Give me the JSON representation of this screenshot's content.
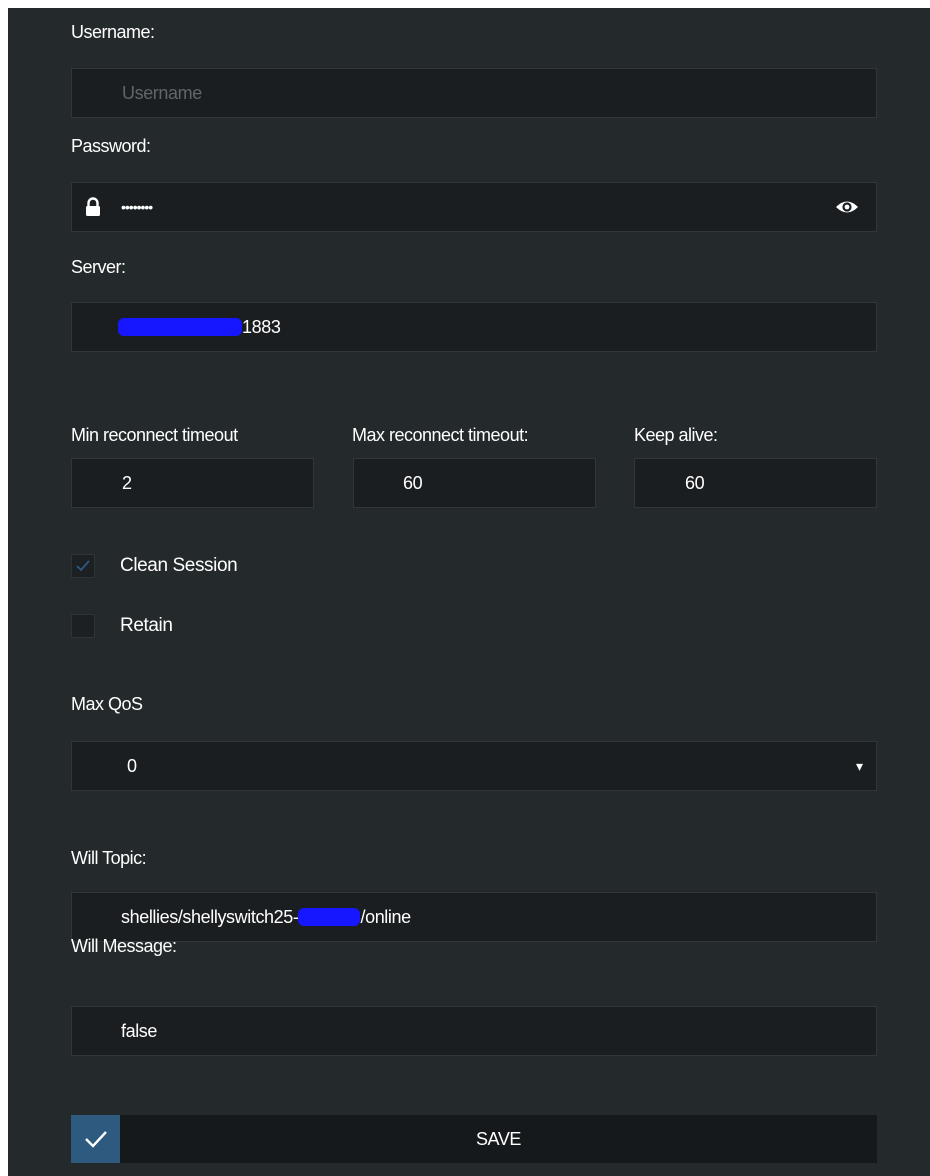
{
  "form": {
    "username": {
      "label": "Username:",
      "placeholder": "Username",
      "value": ""
    },
    "password": {
      "label": "Password:",
      "value": "••••••••",
      "lock_icon": "lock-icon",
      "reveal_icon": "eye-icon"
    },
    "server": {
      "label": "Server:",
      "value_suffix": "1883"
    },
    "min_reconnect": {
      "label": "Min reconnect timeout",
      "value": "2"
    },
    "max_reconnect": {
      "label": "Max reconnect timeout:",
      "value": "60"
    },
    "keep_alive": {
      "label": "Keep alive:",
      "value": "60"
    },
    "clean_session": {
      "label": "Clean Session",
      "checked": true
    },
    "retain": {
      "label": "Retain",
      "checked": false
    },
    "max_qos": {
      "label": "Max QoS",
      "selected": "0",
      "arrow": "▾"
    },
    "will_topic": {
      "label": "Will Topic:",
      "prefix": "shellies/shellyswitch25-",
      "suffix": "/online"
    },
    "will_message": {
      "label": "Will Message:",
      "value": "false"
    },
    "save": {
      "label": "SAVE",
      "icon": "check-icon"
    }
  },
  "colors": {
    "background": "#24292c",
    "field": "#1b1e20",
    "accent": "#2e5a80",
    "redaction": "#1616ff"
  }
}
